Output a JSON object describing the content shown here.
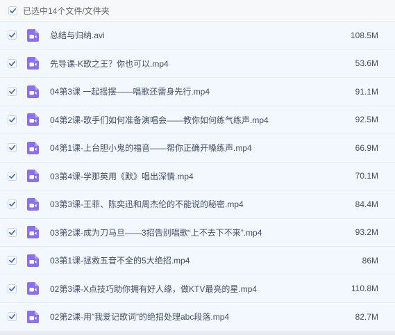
{
  "header": {
    "selection_label": "已选中14个文件/文件夹",
    "checked": true
  },
  "accent_color": "#3b6fd6",
  "icon_color": "#8b6ff0",
  "files": [
    {
      "name": "总结与归纳.avi",
      "size": "108.5M",
      "icon": "video-file-icon",
      "checked": true
    },
    {
      "name": "先导课-K歌之王？你也可以.mp4",
      "size": "53.6M",
      "icon": "video-file-icon",
      "checked": true
    },
    {
      "name": "04第3课 一起摇摆——唱歌还需身先行.mp4",
      "size": "91.1M",
      "icon": "video-file-icon",
      "checked": true
    },
    {
      "name": "04第2课-歌手们如何准备演唱会——教你如何练气练声.mp4",
      "size": "92.5M",
      "icon": "video-file-icon",
      "checked": true
    },
    {
      "name": "04第1课-上台胆小鬼的福音——帮你正确开嗓练声.mp4",
      "size": "66.9M",
      "icon": "video-file-icon",
      "checked": true
    },
    {
      "name": "03第4课-学那英用《默》唱出深情.mp4",
      "size": "70.1M",
      "icon": "video-file-icon",
      "checked": true
    },
    {
      "name": "03第3课-王菲、陈奕迅和周杰伦的不能说的秘密.mp4",
      "size": "84.4M",
      "icon": "video-file-icon",
      "checked": true
    },
    {
      "name": "03第2课-成为刀马旦——3招告别唱歌“上不去下不来”.mp4",
      "size": "93.2M",
      "icon": "video-file-icon",
      "checked": true
    },
    {
      "name": "03第1课-拯救五音不全的5大绝招.mp4",
      "size": "86M",
      "icon": "video-file-icon",
      "checked": true
    },
    {
      "name": "02第3课-X点技巧助你拥有好人缘，做KTV最亮的星.mp4",
      "size": "110.8M",
      "icon": "video-file-icon",
      "checked": true
    },
    {
      "name": "02第2课-用”我爱记歌词”的绝招处理abc段落.mp4",
      "size": "82.7M",
      "icon": "video-file-icon",
      "checked": true
    }
  ]
}
